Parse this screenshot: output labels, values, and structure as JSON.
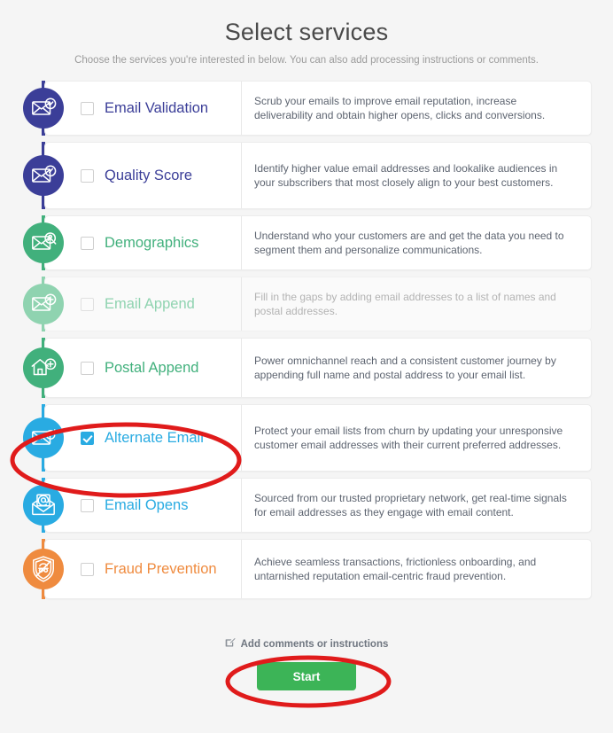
{
  "header": {
    "title": "Select services",
    "subtitle": "Choose the services you're interested in below. You can also add processing instructions or comments."
  },
  "services": [
    {
      "name": "Email Validation",
      "description": "Scrub your emails to improve email reputation, increase deliverability and obtain higher opens, clicks and conversions.",
      "icon": "envelope-check-icon",
      "color": "#3b3e98",
      "checked": false,
      "disabled": false
    },
    {
      "name": "Quality Score",
      "description": "Identify higher value email addresses and lookalike audiences in your subscribers that most closely align to your best customers.",
      "icon": "envelope-gauge-icon",
      "color": "#3b3e98",
      "checked": false,
      "disabled": false
    },
    {
      "name": "Demographics",
      "description": "Understand who your customers are and get the data you need to segment them and personalize communications.",
      "icon": "envelope-person-search-icon",
      "color": "#41b07c",
      "checked": false,
      "disabled": false
    },
    {
      "name": "Email Append",
      "description": "Fill in the gaps by adding email addresses to a list of names and postal addresses.",
      "icon": "envelope-plus-icon",
      "color": "#8fd3b0",
      "checked": false,
      "disabled": true
    },
    {
      "name": "Postal Append",
      "description": "Power omnichannel reach and a consistent customer journey by appending full name and postal address to your email list.",
      "icon": "house-plus-icon",
      "color": "#41b07c",
      "checked": false,
      "disabled": false
    },
    {
      "name": "Alternate Email",
      "description": "Protect your email lists from churn by updating your unresponsive customer email addresses with their current preferred addresses.",
      "icon": "envelope-refresh-icon",
      "color": "#29abe2",
      "checked": true,
      "disabled": false
    },
    {
      "name": "Email Opens",
      "description": "Sourced from our trusted proprietary network, get real-time signals for email addresses as they engage with email content.",
      "icon": "open-envelope-at-icon",
      "color": "#29abe2",
      "checked": false,
      "disabled": false
    },
    {
      "name": "Fraud Prevention",
      "description": "Achieve seamless transactions, frictionless onboarding, and untarnished reputation email-centric fraud prevention.",
      "icon": "shield-no-fraud-icon",
      "color": "#ef8b3f",
      "checked": false,
      "disabled": false
    }
  ],
  "footer": {
    "comments_label": "Add comments or instructions",
    "comments_icon": "edit-pencil-icon",
    "start_label": "Start"
  },
  "annotations": {
    "highlight_color": "#e01b1b",
    "items": [
      {
        "name": "alternate-email-highlight"
      },
      {
        "name": "start-button-highlight"
      }
    ]
  },
  "label_colors": {
    "indigo": "#3b3e98",
    "green": "#41b07c",
    "green_faded": "#9ad9b7",
    "blue": "#29abe2",
    "orange": "#ef8b3f"
  }
}
